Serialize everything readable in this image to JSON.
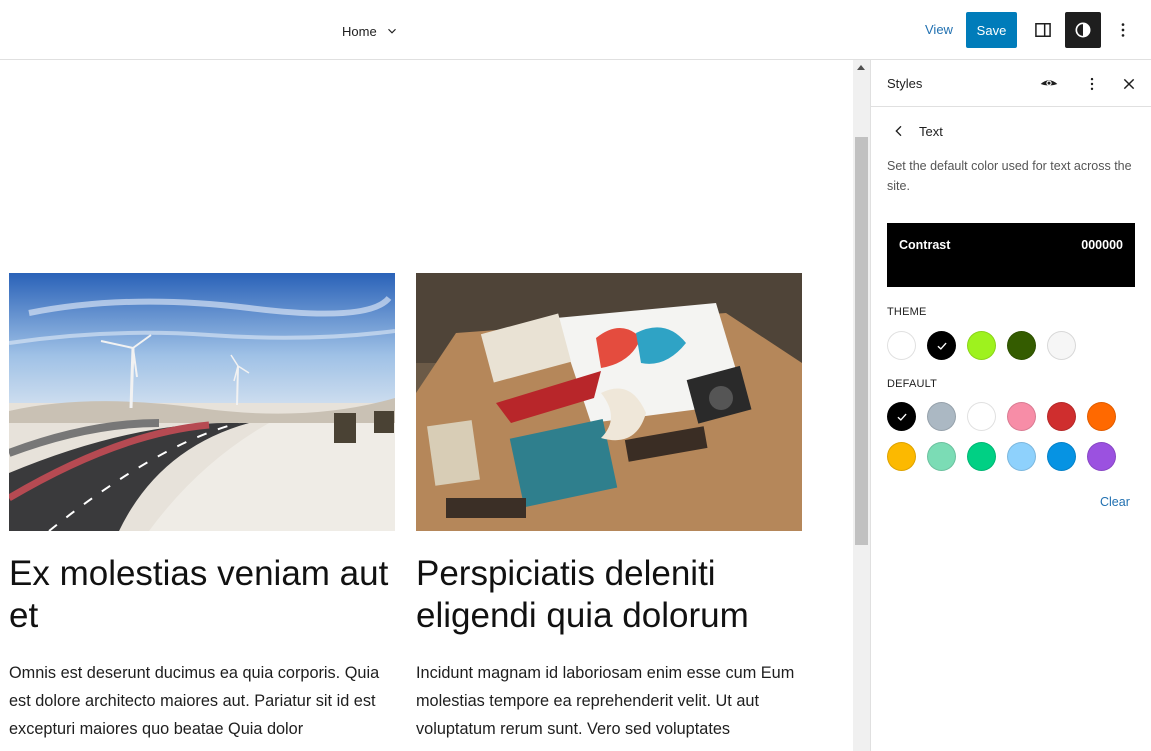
{
  "header": {
    "document_title": "Home",
    "view_label": "View",
    "save_label": "Save"
  },
  "icons": {
    "chevron_down": "chevron-down-icon",
    "sidebar": "sidebar-icon",
    "styles": "half-circle-icon",
    "options": "more-vertical-icon",
    "eye": "eye-icon",
    "close": "close-icon",
    "back": "chevron-left-icon"
  },
  "posts": [
    {
      "title": "Ex molestias veniam aut et",
      "excerpt": "Omnis est deserunt ducimus ea quia corporis. Quia est dolore architecto maiores aut. Pariatur sit id est excepturi maiores quo beatae Quia dolor"
    },
    {
      "title": "Perspiciatis deleniti eligendi quia dolorum",
      "excerpt": "Incidunt magnam id laboriosam enim esse cum Eum molestias tempore ea reprehenderit velit. Ut aut voluptatum rerum sunt. Vero sed voluptates"
    }
  ],
  "sidebar": {
    "title": "Styles",
    "subtitle": "Text",
    "description": "Set the default color used for text across the site.",
    "selected_color": {
      "name": "Contrast",
      "hex": "000000"
    },
    "theme_label": "THEME",
    "default_label": "DEFAULT",
    "clear_label": "Clear",
    "theme_colors": [
      "#ffffff",
      "#000000",
      "#9ef21e",
      "#345c00",
      "#f6f6f6"
    ],
    "default_colors": [
      "#000000",
      "#abb8c3",
      "#ffffff",
      "#f78da7",
      "#cf2e2e",
      "#ff6900",
      "#fcb900",
      "#7bdcb5",
      "#00d084",
      "#8ed1fc",
      "#0693e3",
      "#9b51e0"
    ],
    "selected_theme_index": 1,
    "selected_default_index": 0
  },
  "colors": {
    "accent": "#007cba",
    "link": "#2271b1"
  }
}
